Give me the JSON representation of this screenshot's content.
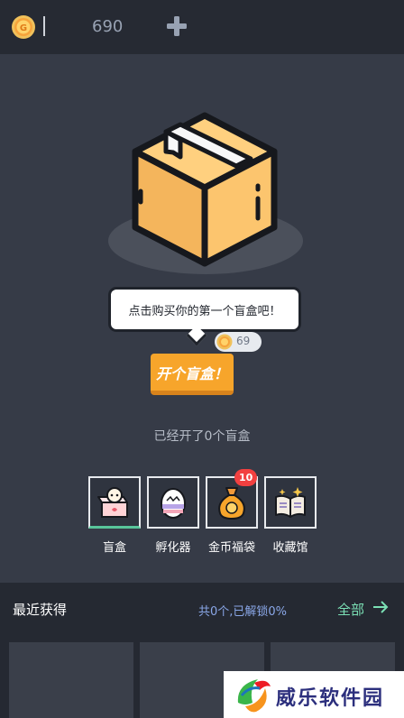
{
  "header": {
    "coin_balance": "690"
  },
  "hero": {
    "speech": "点击购买你的第一个盲盒吧！",
    "price": "69",
    "open_button_label": "开个盲盒！",
    "opened_count_text": "已经开了0个盲盒"
  },
  "shortcuts": [
    {
      "label": "盲盒",
      "active": true
    },
    {
      "label": "孵化器"
    },
    {
      "label": "金币福袋",
      "badge": "10"
    },
    {
      "label": "收藏馆"
    }
  ],
  "recent": {
    "title": "最近获得",
    "stats": "共0个,已解锁0%",
    "all_label": "全部"
  },
  "watermark": {
    "text": "威乐软件园"
  },
  "colors": {
    "background": "#363b47",
    "topbar": "#262a33",
    "accent_orange": "#f7a52b",
    "active_green": "#58c59a",
    "badge_red": "#f24040",
    "link_green": "#7be0b5",
    "stats_blue": "#8aa7e8"
  },
  "icons": [
    "coin-icon",
    "plus-icon",
    "cardboard-box-icon",
    "blind-box-icon",
    "egg-icon",
    "money-bag-icon",
    "book-icon",
    "arrow-right-icon"
  ]
}
